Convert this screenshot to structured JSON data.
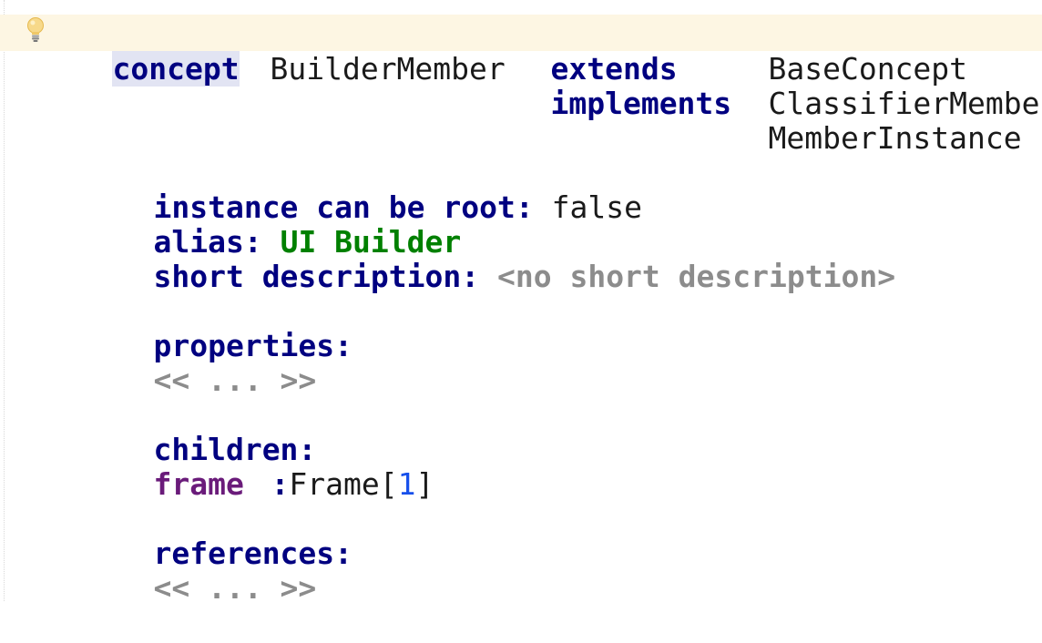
{
  "header": {
    "keyword_concept": "concept",
    "concept_name": "BuilderMember",
    "keyword_extends": "extends",
    "extends_value": "BaseConcept",
    "keyword_implements": "implements",
    "implements": [
      "ClassifierMember",
      "MemberInstance"
    ]
  },
  "settings": {
    "instance_can_be_root_label": "instance can be root:",
    "instance_can_be_root_value": "false",
    "alias_label": "alias:",
    "alias_value": "UI Builder",
    "short_description_label": "short description:",
    "short_description_placeholder": "<no short description>"
  },
  "sections": {
    "properties_label": "properties:",
    "properties_placeholder": "<< ... >>",
    "children_label": "children:",
    "child": {
      "role": "frame",
      "colon": ":",
      "type": "Frame",
      "open_bracket": "[",
      "cardinality": "1",
      "close_bracket": "]"
    },
    "references_label": "references:",
    "references_placeholder": "<< ... >>"
  },
  "icons": {
    "intention_bulb": "lightbulb-icon"
  },
  "colors": {
    "keyword": "#000080",
    "string": "#008000",
    "placeholder": "#8c8c8c",
    "link": "#6a1b7a",
    "number": "#1750eb",
    "current_line": "#fdf6e3"
  }
}
